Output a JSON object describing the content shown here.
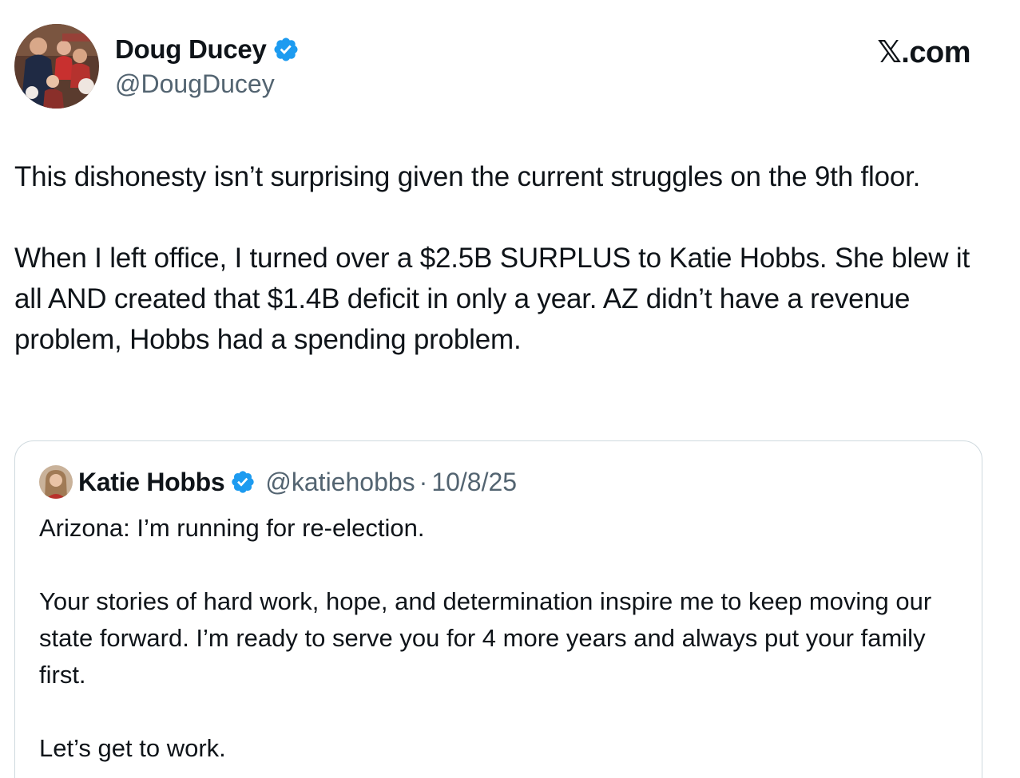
{
  "author": {
    "name": "Doug Ducey",
    "handle": "@DougDucey",
    "avatar_icon": "profile-photo-icon",
    "verified_icon": "verified-badge-icon"
  },
  "site": {
    "logo_text": "𝕏.com"
  },
  "tweet": {
    "paragraphs": [
      "This dishonesty isn’t surprising given the current struggles on the 9th floor.",
      "When I left office, I turned over a $2.5B SURPLUS to Katie Hobbs. She blew it all AND created that $1.4B deficit in only a year. AZ didn’t have a revenue problem, Hobbs had a spending problem."
    ]
  },
  "quoted_tweet": {
    "name": "Katie Hobbs",
    "handle": "@katiehobbs",
    "separator": "·",
    "date": "10/8/25",
    "paragraphs": [
      "Arizona: I’m running for re-election.",
      "Your stories of hard work, hope, and determination inspire me to keep moving our state forward. I’m ready to serve you for 4 more years and always put your family first.",
      "Let’s get to work."
    ]
  },
  "colors": {
    "text_primary": "#0f1419",
    "text_secondary": "#536471",
    "verified_blue": "#1d9bf0",
    "card_border": "#cfd9de"
  }
}
